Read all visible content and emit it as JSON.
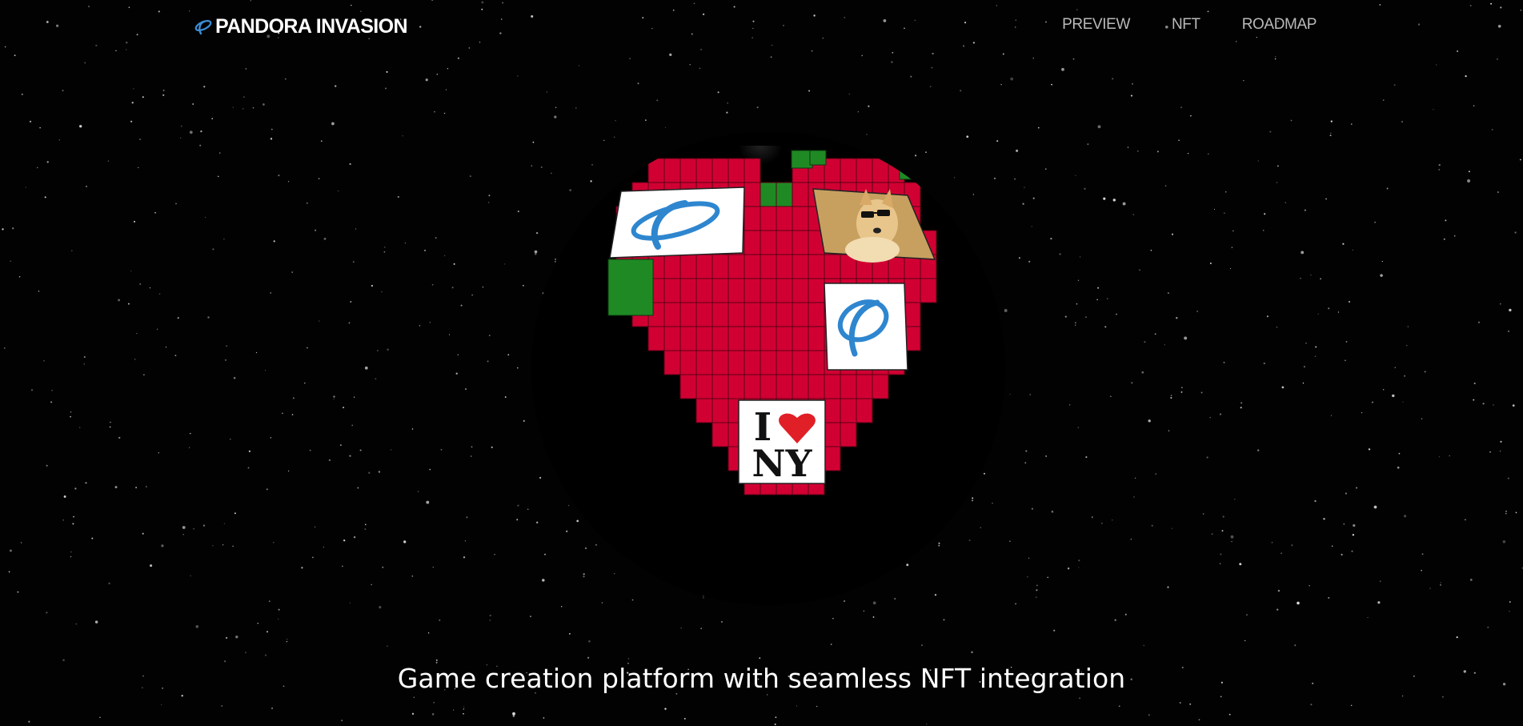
{
  "header": {
    "brand_name": "PANDORA INVASION",
    "brand_icon": "pandora-logo-icon",
    "nav": [
      {
        "label": "PREVIEW"
      },
      {
        "label": "NFT"
      },
      {
        "label": "ROADMAP"
      }
    ]
  },
  "planet": {
    "tile_colors": {
      "red": "#d10033",
      "green": "#1f8a24",
      "white": "#ffffff",
      "glow": "#7fa9c4"
    },
    "tiles": [
      {
        "icon": "pandora-logo-icon"
      },
      {
        "icon": "doge-sunglasses-image"
      },
      {
        "icon": "pandora-logo-icon"
      },
      {
        "icon": "i-love-ny-icon",
        "text_top": "I",
        "text_bottom": "NY"
      }
    ]
  },
  "hero": {
    "tagline": "Game creation platform with seamless NFT integration"
  }
}
